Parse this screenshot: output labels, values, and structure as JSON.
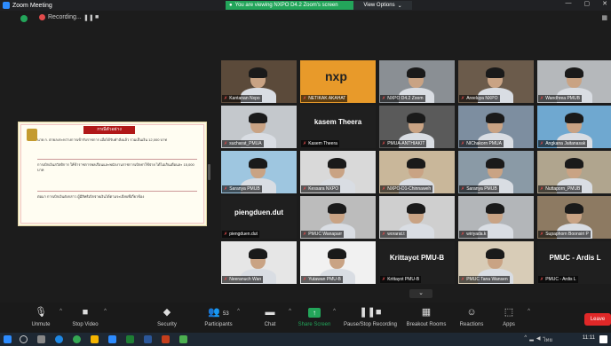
{
  "window": {
    "title": "Zoom Meeting",
    "viewing_banner": "You are viewing NXPO D4.2 Zoom's screen",
    "view_options": "View Options",
    "recording_label": "Recording..."
  },
  "shared_screen": {
    "title": "กรณีตัวอย่าง",
    "paragraph1": "นาย ก. ตายลงระหว่างการเข้ารับราชการ เมื่อได้รับคำสั่งแล้ว รวมเป็นเงิน 12,000 บาท",
    "paragraph2": "การเบิกเงินสวัสดิการ ให้ข้าราชการพลเรือนและพนักงานราชการเบิกค่าใช้จ่าย ได้ไม่เกินเดือนละ 15,000 บาท",
    "paragraph3": "ต่อมา การเบิกเงินดังกล่าว ผู้มีสิทธิเบิกจ่ายเงินได้ตามระเบียบที่เกี่ยวข้อง"
  },
  "participants": [
    {
      "name": "Kantanan Nxpo",
      "style": "video",
      "bg": "#5b4a3a",
      "active": true
    },
    {
      "name": "NETIKAK AKAHAT",
      "style": "video",
      "bg": "#e89a2a",
      "overlay": "nxp"
    },
    {
      "name": "NXPO D4.2 Zoom",
      "style": "video",
      "bg": "#8a8f94"
    },
    {
      "name": "Areeluya NXPO",
      "style": "video",
      "bg": "#6b5b4b"
    },
    {
      "name": "Wandhrea PMUB",
      "style": "video",
      "bg": "#b5b8bb"
    },
    {
      "name": "sucharat_PMUA",
      "style": "video",
      "bg": "#c4c8cc"
    },
    {
      "name": "Kasem Theera",
      "style": "text",
      "big": "kasem Theera"
    },
    {
      "name": "PMUA-ANTHIAKIT",
      "style": "video",
      "bg": "#5a5a5a"
    },
    {
      "name": "NIChakorn PMUA",
      "style": "video",
      "bg": "#7d8ea0"
    },
    {
      "name": "Angkana Jaitanasak",
      "style": "video",
      "bg": "#6fa8d0"
    },
    {
      "name": "Saranya PMUB",
      "style": "video",
      "bg": "#9ec6e0"
    },
    {
      "name": "Kessara NXPO",
      "style": "video",
      "bg": "#d9d9d9"
    },
    {
      "name": "NXPO-D1-Chinnaweh",
      "style": "video",
      "bg": "#c9b79a"
    },
    {
      "name": "Saranya PMUB",
      "style": "video",
      "bg": "#8a9aa6"
    },
    {
      "name": "Nuttaporn_PMUB",
      "style": "video",
      "bg": "#b0a58e"
    },
    {
      "name": "piengduen.dut",
      "style": "text",
      "big": "piengduen.dut"
    },
    {
      "name": "PMUC Wanaparr",
      "style": "video",
      "bg": "#bcbcbc"
    },
    {
      "name": "worarat.t",
      "style": "video",
      "bg": "#cfcfcf"
    },
    {
      "name": "wiriyada.k",
      "style": "video",
      "bg": "#b3b6b9"
    },
    {
      "name": "Supaphorn Boonsiri P",
      "style": "video",
      "bg": "#8d7a62"
    },
    {
      "name": "Neeranuch Wan",
      "style": "video",
      "bg": "#e6e6e6"
    },
    {
      "name": "Yutawan PMU-B",
      "style": "video",
      "bg": "#f1f1f1"
    },
    {
      "name": "Krittayot PMU-B",
      "style": "text",
      "big": "Krittayot PMU-B"
    },
    {
      "name": "PMUC Tana Wansen",
      "style": "video",
      "bg": "#d8ccb7"
    },
    {
      "name": "PMUC - Ardis L",
      "style": "text",
      "big": "PMUC - Ardis L"
    }
  ],
  "toolbar": {
    "unmute": "Unmute",
    "stop_video": "Stop Video",
    "security": "Security",
    "participants": "Participants",
    "participants_count": "53",
    "chat": "Chat",
    "share_screen": "Share Screen",
    "pause_stop_recording": "Pause/Stop Recording",
    "breakout_rooms": "Breakout Rooms",
    "reactions": "Reactions",
    "apps": "Apps",
    "leave": "Leave"
  },
  "taskbar": {
    "language": "ไทย",
    "time": "11:11"
  },
  "colors": {
    "accent_green": "#23a55a",
    "leave_red": "#e02828",
    "active_speaker": "#f5d400"
  }
}
